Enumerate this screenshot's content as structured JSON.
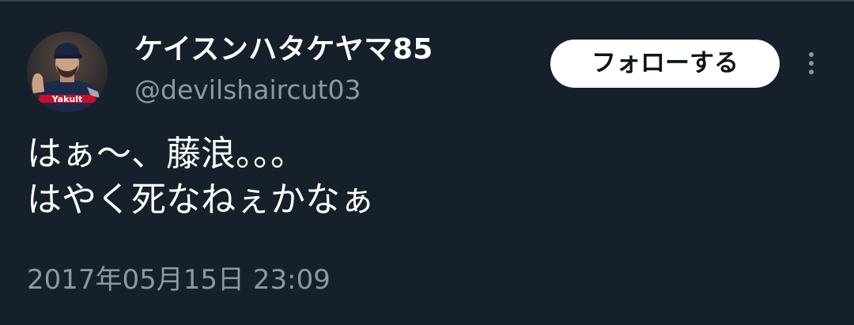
{
  "tweet": {
    "author": {
      "display_name": "ケイスンハタケヤマ85",
      "handle": "@devilshaircut03",
      "avatar_icon": "avatar-photo"
    },
    "follow_label": "フォローする",
    "more_icon": "more-horizontal-icon",
    "text_lines": [
      "はぁ〜、藤浪。。。",
      "はやく死なねぇかなぁ"
    ],
    "timestamp": "2017年05月15日 23:09"
  },
  "colors": {
    "background": "#15202b",
    "text_primary": "#ffffff",
    "text_secondary": "#8b98a5",
    "follow_button_bg": "#ffffff",
    "follow_button_text": "#0f1419"
  }
}
